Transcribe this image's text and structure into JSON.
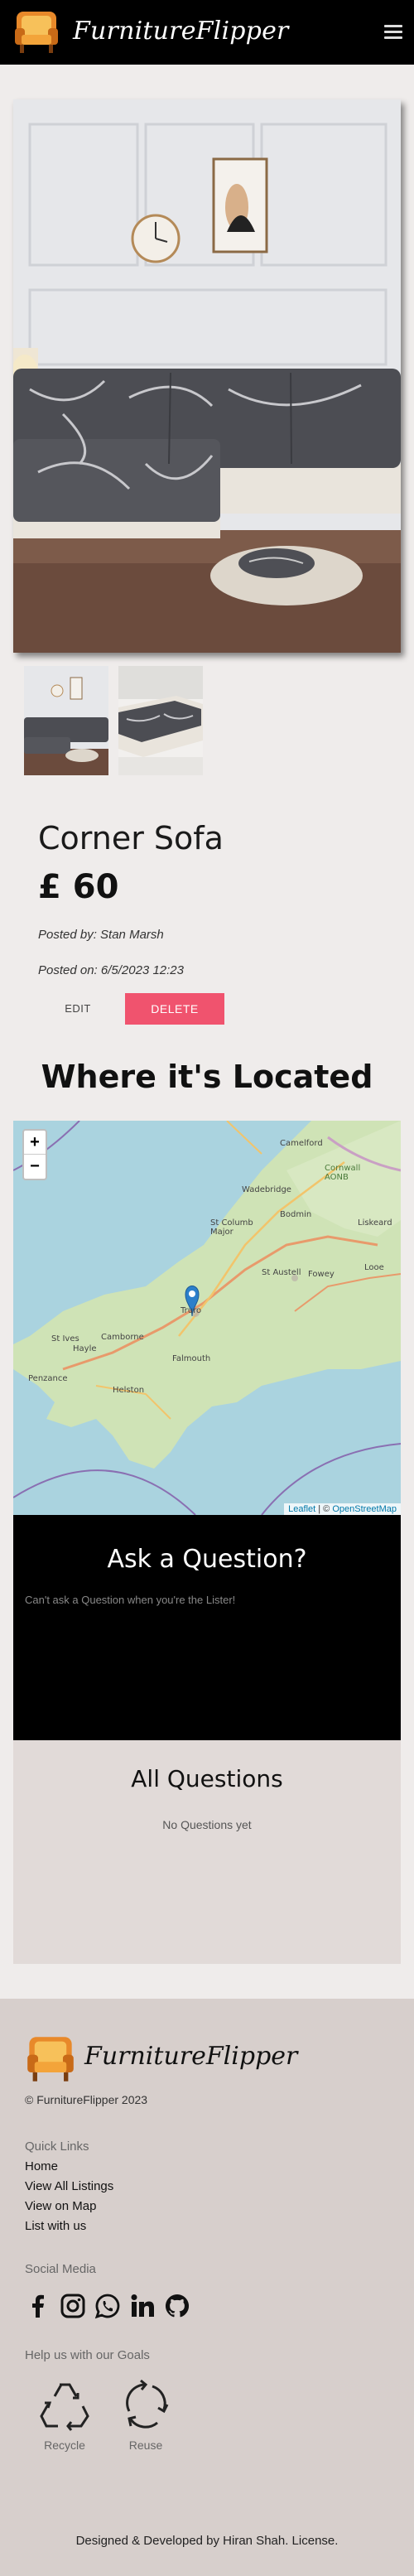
{
  "navbar": {
    "brand": "FurnitureFlipper"
  },
  "listing": {
    "title": "Corner Sofa",
    "price": "£ 60",
    "posted_by": "Posted by: Stan Marsh",
    "posted_on": "Posted on: 6/5/2023 12:23",
    "edit_label": "EDIT",
    "delete_label": "DELETE"
  },
  "location": {
    "heading": "Where it's Located",
    "zoom_in": "+",
    "zoom_out": "−",
    "attribution_leaflet": "Leaflet",
    "attribution_sep": " | © ",
    "attribution_osm": "OpenStreetMap",
    "place_labels": [
      "Camelford",
      "Cornwall AONB",
      "Wadebridge",
      "Bodmin",
      "St Columb Major",
      "Liskeard",
      "St Austell",
      "Fowey",
      "Looe",
      "Truro",
      "Camborne",
      "St Ives",
      "Hayle",
      "Penzance",
      "Falmouth",
      "Helston"
    ]
  },
  "ask": {
    "heading": "Ask a Question?",
    "notice": "Can't ask a Question when you're the Lister!"
  },
  "questions": {
    "heading": "All Questions",
    "empty": "No Questions yet"
  },
  "footer": {
    "brand": "FurnitureFlipper",
    "copyright": "© FurnitureFlipper 2023",
    "quick_links_heading": "Quick Links",
    "links": [
      "Home",
      "View All Listings",
      "View on Map",
      "List with us"
    ],
    "social_heading": "Social Media",
    "social": [
      "facebook-icon",
      "instagram-icon",
      "whatsapp-icon",
      "linkedin-icon",
      "github-icon"
    ],
    "goals_heading": "Help us with our Goals",
    "goals": [
      "Recycle",
      "Reuse"
    ],
    "credit": "Designed & Developed by Hiran Shah. License."
  },
  "colors": {
    "navbar": "#000000",
    "accent": "#f0536e",
    "background": "#efeceb",
    "footer": "#d7cfcc"
  }
}
